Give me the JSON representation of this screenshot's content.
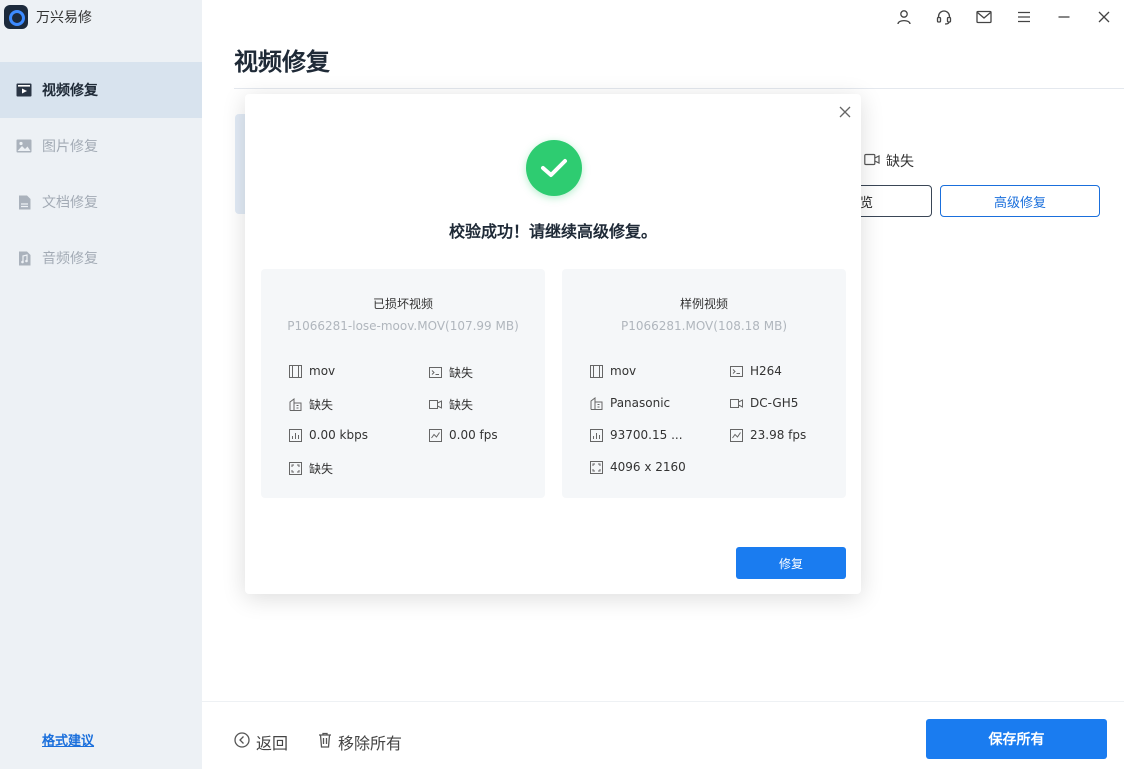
{
  "app": {
    "name": "万兴易修"
  },
  "sidebar": {
    "items": [
      {
        "label": "视频修复",
        "icon": "video-icon",
        "active": true
      },
      {
        "label": "图片修复",
        "icon": "image-icon",
        "active": false
      },
      {
        "label": "文档修复",
        "icon": "document-icon",
        "active": false
      },
      {
        "label": "音频修复",
        "icon": "audio-icon",
        "active": false
      }
    ],
    "format_link": "格式建议"
  },
  "topbar": {
    "icons": [
      "user-icon",
      "headset-icon",
      "mail-icon",
      "menu-icon",
      "minimize-icon",
      "close-icon"
    ]
  },
  "main": {
    "title": "视频修复",
    "bg_missing_label": "缺失",
    "bg_preview_label": "览",
    "bg_advanced_label": "高级修复"
  },
  "footer": {
    "back_label": "返回",
    "remove_all_label": "移除所有",
    "save_all_label": "保存所有"
  },
  "modal": {
    "message": "校验成功！请继续高级修复。",
    "repair_label": "修复",
    "damaged": {
      "title": "已损坏视频",
      "file": "P1066281-lose-moov.MOV(107.99  MB)",
      "format": "mov",
      "codec": "缺失",
      "brand": "缺失",
      "camera": "缺失",
      "bitrate": "0.00 kbps",
      "fps": "0.00 fps",
      "resolution": "缺失"
    },
    "sample": {
      "title": "样例视频",
      "file": "P1066281.MOV(108.18  MB)",
      "format": "mov",
      "codec": "H264",
      "brand": "Panasonic",
      "camera": "DC-GH5",
      "bitrate": "93700.15 ...",
      "fps": "23.98 fps",
      "resolution": "4096 x 2160"
    }
  },
  "colors": {
    "accent": "#1a7cf0",
    "success": "#2ecc71",
    "sidebar_bg": "#edf1f5"
  }
}
